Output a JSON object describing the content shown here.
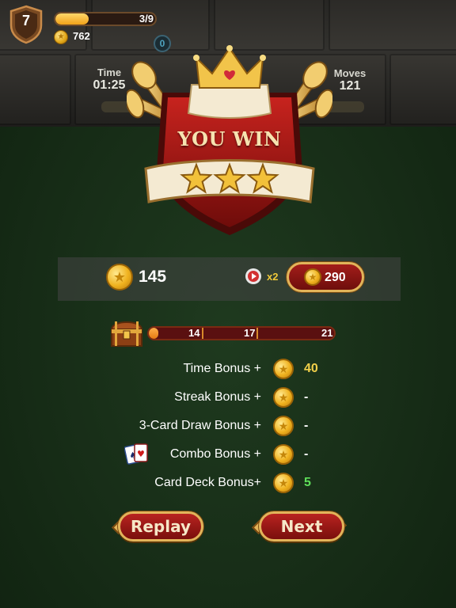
{
  "hud": {
    "level": "7",
    "xp_progress_text": "3/9",
    "xp_fraction": 0.33,
    "coins": "762",
    "score": "0"
  },
  "game_stats": {
    "time_label": "Time",
    "time_value": "01:25",
    "moves_label": "Moves",
    "moves_value": "121"
  },
  "banner": {
    "title": "YOU WIN",
    "stars": 3
  },
  "reward": {
    "amount": "145",
    "multiplier": "x2",
    "doubled_amount": "290"
  },
  "chest_progress": {
    "fraction": 0.05,
    "milestones": [
      "14",
      "17",
      "21"
    ]
  },
  "bonuses": [
    {
      "label": "Time Bonus +",
      "value": "40",
      "color": "#f2d04a"
    },
    {
      "label": "Streak Bonus +",
      "value": "-",
      "color": "#ffffff"
    },
    {
      "label": "3-Card Draw Bonus +",
      "value": "-",
      "color": "#ffffff"
    },
    {
      "label": "Combo Bonus +",
      "value": "-",
      "color": "#ffffff"
    },
    {
      "label": "Card Deck Bonus+",
      "value": "5",
      "color": "#5fe05a"
    }
  ],
  "buttons": {
    "replay": "Replay",
    "next": "Next"
  },
  "colors": {
    "felt": "#172d17",
    "gold": "#e2b45a",
    "button_red": "#b82320"
  }
}
